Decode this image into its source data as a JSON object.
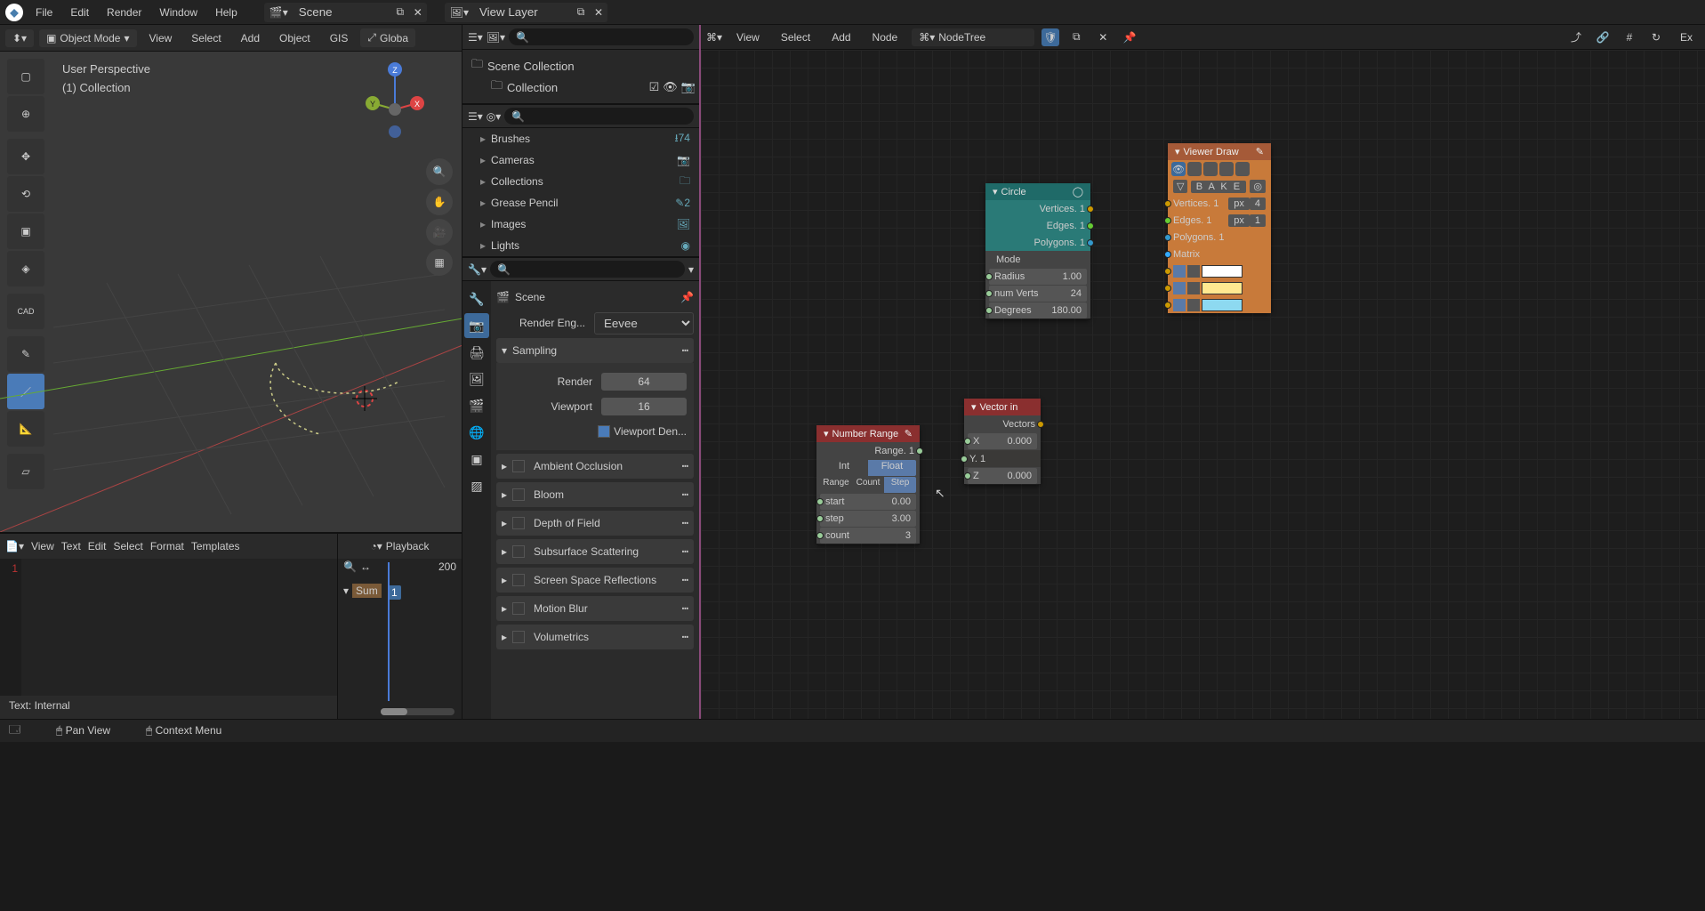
{
  "topbar": {
    "menus": [
      "File",
      "Edit",
      "Render",
      "Window",
      "Help"
    ],
    "scene_label": "Scene",
    "viewlayer_label": "View Layer"
  },
  "viewport": {
    "header": {
      "mode": "Object Mode",
      "menus": [
        "View",
        "Select",
        "Add",
        "Object",
        "GIS"
      ],
      "global": "Globa"
    },
    "info_line1": "User Perspective",
    "info_line2": "(1)  Collection",
    "tool_cad": "CAD"
  },
  "outliner": {
    "root": "Scene Collection",
    "child": "Collection"
  },
  "databrowser": {
    "items": [
      {
        "label": "Brushes",
        "badge": "⭳74"
      },
      {
        "label": "Cameras",
        "badge": "📷"
      },
      {
        "label": "Collections",
        "badge": "🗀"
      },
      {
        "label": "Grease Pencil",
        "badge": "✎2"
      },
      {
        "label": "Images",
        "badge": "🖼"
      },
      {
        "label": "Lights",
        "badge": "◉"
      }
    ]
  },
  "properties": {
    "crumb": "Scene",
    "render_engine_label": "Render Eng...",
    "render_engine_value": "Eevee",
    "sampling": {
      "title": "Sampling",
      "render_label": "Render",
      "render_value": "64",
      "viewport_label": "Viewport",
      "viewport_value": "16",
      "viewport_den": "Viewport Den..."
    },
    "panels": [
      "Ambient Occlusion",
      "Bloom",
      "Depth of Field",
      "Subsurface Scattering",
      "Screen Space Reflections",
      "Motion Blur",
      "Volumetrics"
    ]
  },
  "text_editor": {
    "menus": [
      "View",
      "Text",
      "Edit",
      "Select",
      "Format",
      "Templates"
    ],
    "line": "1",
    "status": "Text: Internal"
  },
  "dopesheet": {
    "playback": "Playback",
    "frame_end": "200",
    "frame_cur": "1",
    "summary": "Sum"
  },
  "statusbar": {
    "pan": "Pan View",
    "ctx": "Context Menu"
  },
  "node_editor": {
    "menus": [
      "View",
      "Select",
      "Add",
      "Node"
    ],
    "tree": "NodeTree",
    "ex": "Ex"
  },
  "nodes": {
    "circle": {
      "title": "Circle",
      "out_vertices": "Vertices. 1",
      "out_edges": "Edges. 1",
      "out_polygons": "Polygons. 1",
      "mode": "Mode",
      "radius_l": "Radius",
      "radius_v": "1.00",
      "verts_l": "num Verts",
      "verts_v": "24",
      "deg_l": "Degrees",
      "deg_v": "180.00"
    },
    "viewer": {
      "title": "Viewer Draw",
      "bake": "B A K E",
      "in_vertices": "Vertices. 1",
      "vpx": "px",
      "v4": "4",
      "in_edges": "Edges. 1",
      "epx": "px",
      "e1": "1",
      "in_polygons": "Polygons. 1",
      "matrix": "Matrix"
    },
    "range": {
      "title": "Number Range",
      "out": "Range. 1",
      "int": "Int",
      "float": "Float",
      "mode_range": "Range",
      "mode_count": "Count",
      "mode_step": "Step",
      "start_l": "start",
      "start_v": "0.00",
      "step_l": "step",
      "step_v": "3.00",
      "count_l": "count",
      "count_v": "3"
    },
    "vector": {
      "title": "Vector in",
      "out": "Vectors",
      "x_l": "X",
      "x_v": "0.000",
      "y_l": "Y. 1",
      "z_l": "Z",
      "z_v": "0.000"
    }
  }
}
